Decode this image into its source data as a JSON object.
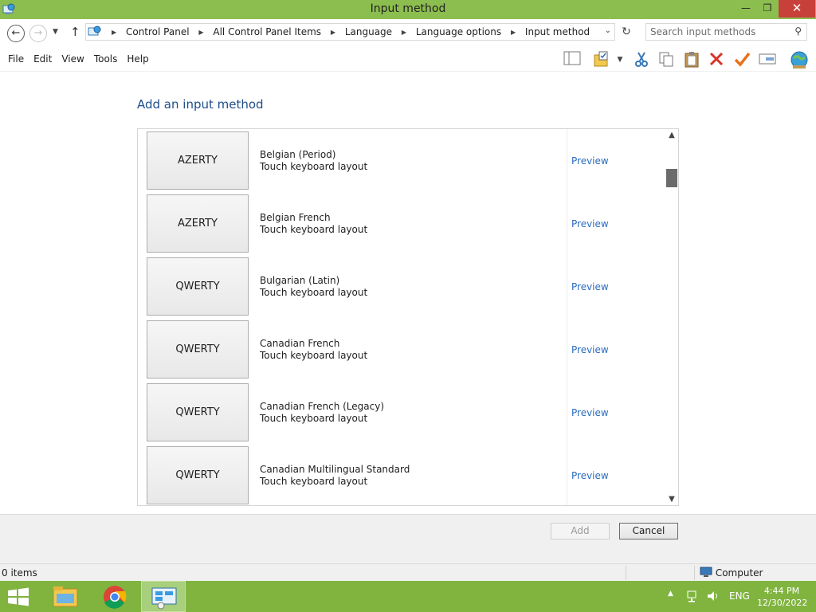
{
  "window": {
    "title": "Input method",
    "minimize_glyph": "—",
    "maximize_glyph": "❐",
    "close_glyph": "✕"
  },
  "address": {
    "crumbs": [
      "Control Panel",
      "All Control Panel Items",
      "Language",
      "Language options",
      "Input method"
    ],
    "search_placeholder": "Search input methods"
  },
  "menu": [
    "File",
    "Edit",
    "View",
    "Tools",
    "Help"
  ],
  "toolbar": [
    "layout-icon",
    "folder-check-icon",
    "cut-icon",
    "copy-icon",
    "paste-icon",
    "delete-icon",
    "check-icon",
    "properties-icon",
    "globe-icon"
  ],
  "content": {
    "heading": "Add an input method",
    "items": [
      {
        "layout": "AZERTY",
        "name": "Belgian (Period)",
        "desc": "Touch keyboard layout",
        "preview": "Preview"
      },
      {
        "layout": "AZERTY",
        "name": "Belgian French",
        "desc": "Touch keyboard layout",
        "preview": "Preview"
      },
      {
        "layout": "QWERTY",
        "name": "Bulgarian (Latin)",
        "desc": "Touch keyboard layout",
        "preview": "Preview"
      },
      {
        "layout": "QWERTY",
        "name": "Canadian French",
        "desc": "Touch keyboard layout",
        "preview": "Preview"
      },
      {
        "layout": "QWERTY",
        "name": "Canadian French (Legacy)",
        "desc": "Touch keyboard layout",
        "preview": "Preview"
      },
      {
        "layout": "QWERTY",
        "name": "Canadian Multilingual Standard",
        "desc": "Touch keyboard layout",
        "preview": "Preview"
      }
    ]
  },
  "buttons": {
    "add": "Add",
    "cancel": "Cancel"
  },
  "status": {
    "items": "0 items",
    "location": "Computer"
  },
  "taskbar": {
    "lang": "ENG",
    "time": "4:44 PM",
    "date": "12/30/2022"
  },
  "colors": {
    "accent": "#8cbe4f",
    "taskbar": "#80b43f",
    "link": "#2a6bbf",
    "heading": "#1e4e8c",
    "close": "#c7413a"
  }
}
